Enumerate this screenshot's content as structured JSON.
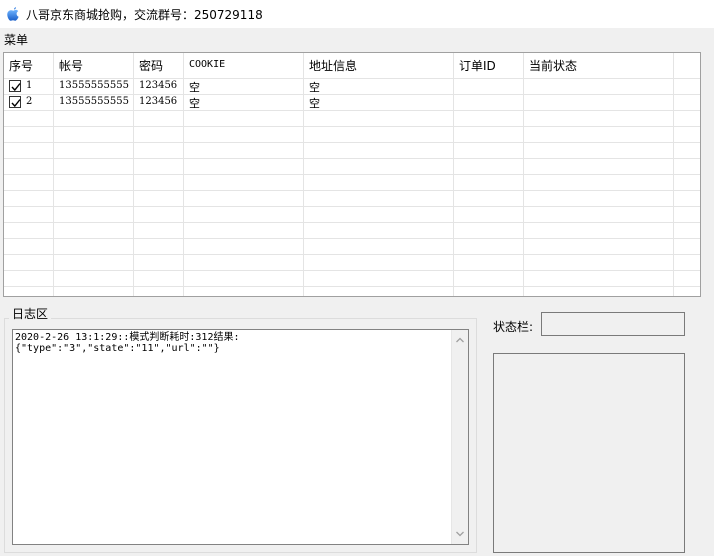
{
  "window": {
    "title": "八哥京东商城抢购，交流群号：250729118",
    "icon": "apple-icon"
  },
  "menu": {
    "label": "菜单"
  },
  "table": {
    "columns": [
      "序号",
      "帐号",
      "密码",
      "COOKIE",
      "地址信息",
      "订单ID",
      "当前状态"
    ],
    "rows": [
      {
        "checked": true,
        "index": "1",
        "account": "13555555555",
        "password": "123456",
        "cookie": "空",
        "address": "空",
        "order_id": "",
        "status": ""
      },
      {
        "checked": true,
        "index": "2",
        "account": "13555555555",
        "password": "123456",
        "cookie": "空",
        "address": "空",
        "order_id": "",
        "status": ""
      }
    ]
  },
  "log": {
    "title": "日志区",
    "text": "2020-2-26 13:1:29::模式判断耗时:312结果:\n{\"type\":\"3\",\"state\":\"11\",\"url\":\"\"}"
  },
  "status": {
    "label": "状态栏:",
    "value": ""
  }
}
